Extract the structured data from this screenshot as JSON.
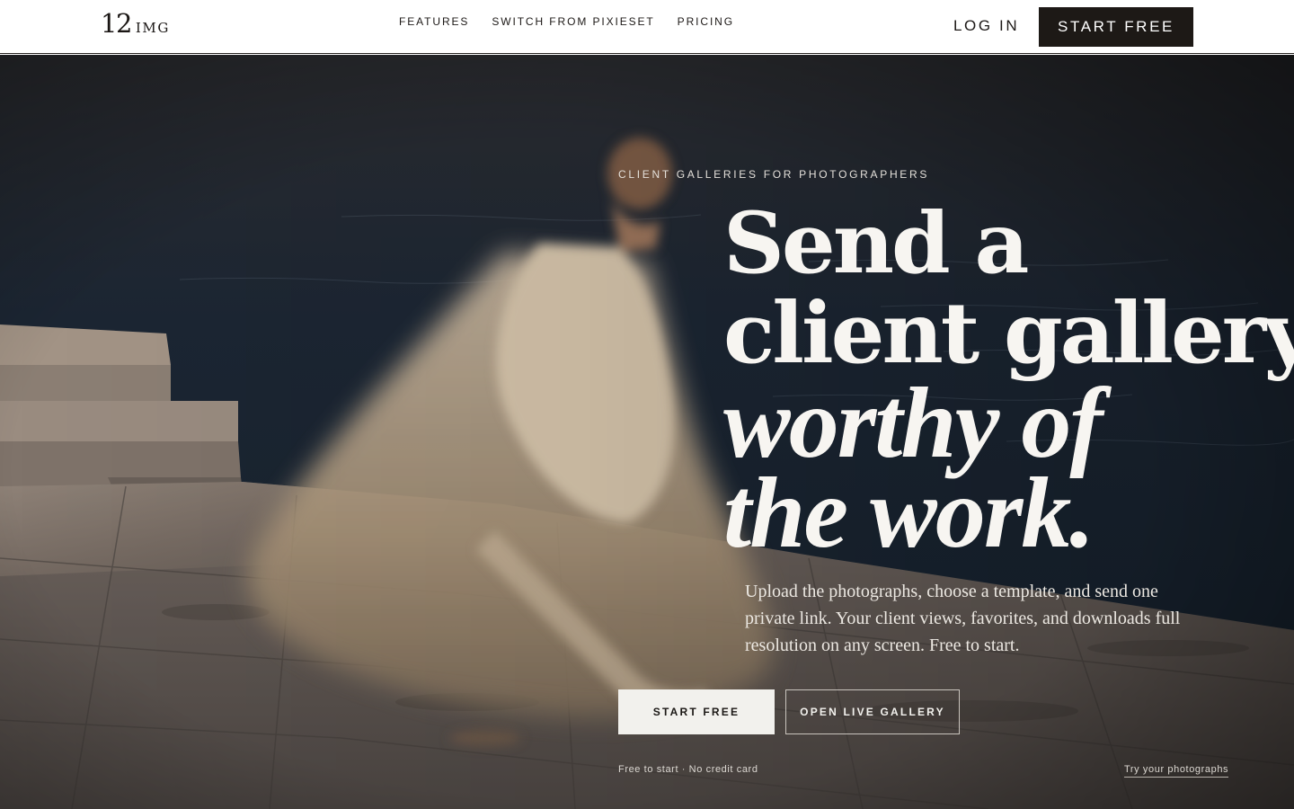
{
  "header": {
    "logo": {
      "number": "12",
      "word": "IMG"
    },
    "nav": [
      {
        "label": "FEATURES"
      },
      {
        "label": "SWITCH FROM PIXIESET"
      },
      {
        "label": "PRICING"
      }
    ],
    "login_label": "LOG IN",
    "start_label": "START FREE"
  },
  "hero": {
    "eyebrow": "CLIENT GALLERIES FOR PHOTOGRAPHERS",
    "headline": {
      "line1": "Send a",
      "line2": "client gallery",
      "line3": "worthy of",
      "line4": "the work."
    },
    "lede": "Upload the photographs, choose a template, and send one private link. Your client views, favorites, and downloads full resolution on any screen. Free to start.",
    "primary_cta": "START FREE",
    "secondary_cta": "OPEN LIVE GALLERY",
    "note": "Free to start · No credit card",
    "try_link": "Try your photographs"
  },
  "colors": {
    "dark": "#1d1916",
    "sea": "#1a2533",
    "stone": "#8a7d72",
    "dress": "#b8a48a",
    "light_button": "#f2f1ed"
  }
}
